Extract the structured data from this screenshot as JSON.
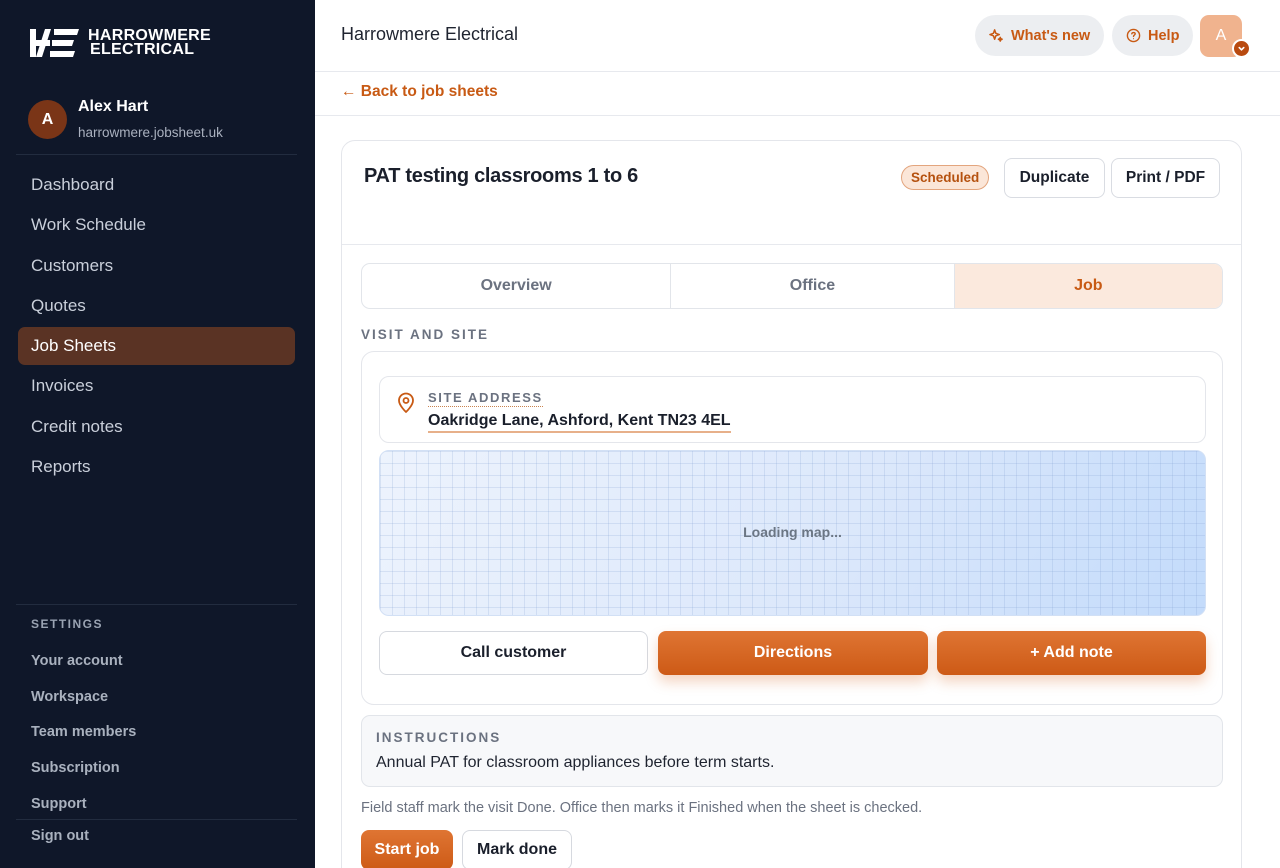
{
  "brand": {
    "line1": "HARROWMERE",
    "line2": "ELECTRICAL",
    "logo_icon": "he-monogram-icon"
  },
  "user": {
    "initial": "A",
    "name": "Alex Hart",
    "domain": "harrowmere.jobsheet.uk"
  },
  "nav": {
    "active": "Job Sheets",
    "items": [
      "Dashboard",
      "Work Schedule",
      "Customers",
      "Quotes",
      "Job Sheets",
      "Invoices",
      "Credit notes",
      "Reports"
    ]
  },
  "settings": {
    "heading": "SETTINGS",
    "items": [
      "Your account",
      "Workspace",
      "Team members",
      "Subscription",
      "Support"
    ],
    "sign_out": "Sign out"
  },
  "topbar": {
    "title": "Harrowmere Electrical",
    "whats_new": "What's new",
    "help": "Help",
    "avatar_initial": "A"
  },
  "back_link": "← Back to job sheets",
  "job": {
    "title": "PAT testing classrooms 1 to 6",
    "status": "Scheduled",
    "duplicate": "Duplicate",
    "print": "Print / PDF",
    "tabs": [
      "Overview",
      "Office",
      "Job"
    ],
    "active_tab": "Job"
  },
  "visit": {
    "section_label": "VISIT AND SITE",
    "address_label": "SITE ADDRESS",
    "address": "Oakridge Lane, Ashford, Kent TN23 4EL",
    "map_status": "Loading map...",
    "call_customer": "Call customer",
    "directions": "Directions",
    "add_note": "+ Add note"
  },
  "instructions": {
    "label": "INSTRUCTIONS",
    "text": "Annual PAT for classroom appliances before term starts."
  },
  "help_text": "Field staff mark the visit Done. Office then marks it Finished when the sheet is checked.",
  "actions": {
    "start": "Start job",
    "done": "Mark done"
  },
  "colors": {
    "accent": "#c85a14",
    "sidebar": "#0f1729",
    "active_nav": "#5a3324",
    "active_tab_bg": "#fbe9dd"
  }
}
